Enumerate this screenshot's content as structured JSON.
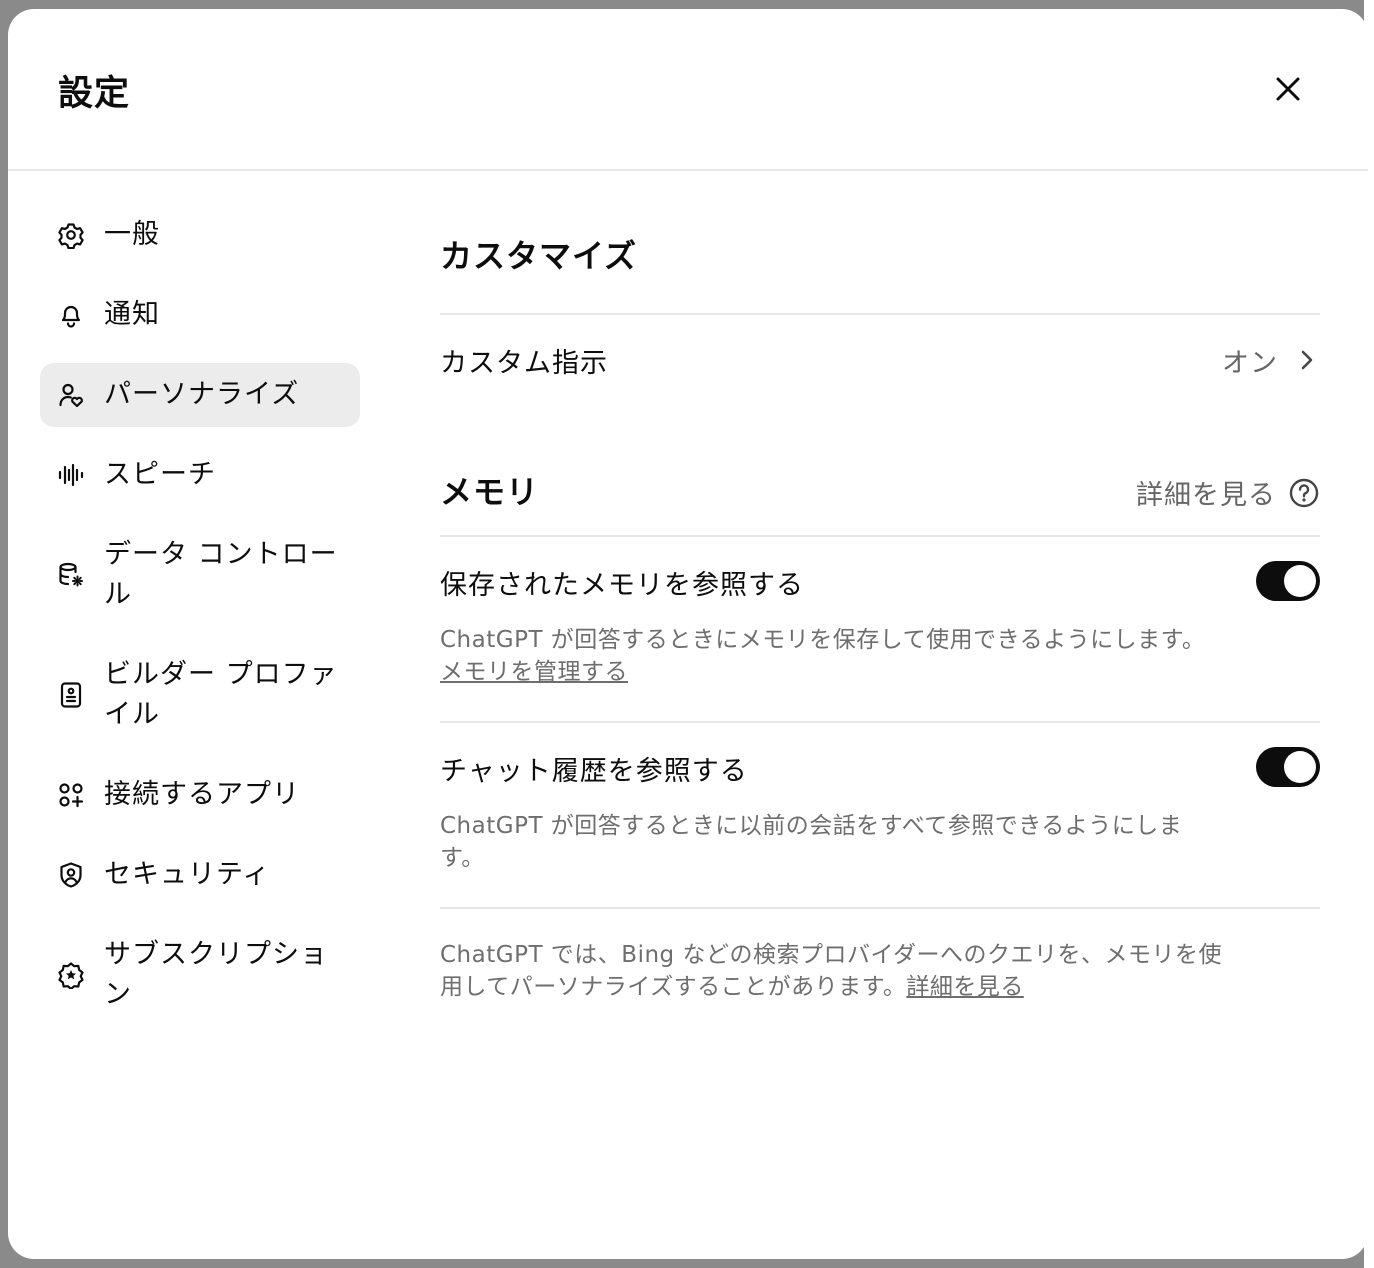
{
  "modal": {
    "title": "設定",
    "close_icon": "close-icon"
  },
  "sidebar": {
    "items": [
      {
        "label": "一般",
        "icon": "gear-icon"
      },
      {
        "label": "通知",
        "icon": "bell-icon"
      },
      {
        "label": "パーソナライズ",
        "icon": "person-heart-icon",
        "active": true
      },
      {
        "label": "スピーチ",
        "icon": "waveform-icon"
      },
      {
        "label": "データ コントロール",
        "icon": "database-gear-icon"
      },
      {
        "label": "ビルダー プロファイル",
        "icon": "id-card-icon"
      },
      {
        "label": "接続するアプリ",
        "icon": "apps-plus-icon"
      },
      {
        "label": "セキュリティ",
        "icon": "shield-user-icon"
      },
      {
        "label": "サブスクリプション",
        "icon": "star-badge-icon"
      }
    ]
  },
  "customize": {
    "title": "カスタマイズ",
    "custom_instructions": {
      "label": "カスタム指示",
      "value": "オン"
    }
  },
  "memory": {
    "title": "メモリ",
    "learn_more": "詳細を見る",
    "saved_memory": {
      "label": "保存されたメモリを参照する",
      "enabled": true,
      "description": "ChatGPT が回答するときにメモリを保存して使用できるようにします。",
      "manage_link": "メモリを管理する"
    },
    "chat_history": {
      "label": "チャット履歴を参照する",
      "enabled": true,
      "description": "ChatGPT が回答するときに以前の会話をすべて参照できるようにします。"
    },
    "footer_note": "ChatGPT では、Bing などの検索プロバイダーへのクエリを、メモリを使用してパーソナライズすることがあります。",
    "footer_link": "詳細を見る"
  },
  "colors": {
    "accent_toggle": "#0d0d0d",
    "active_nav_bg": "#ececec",
    "muted_text": "#6e6e6e"
  }
}
